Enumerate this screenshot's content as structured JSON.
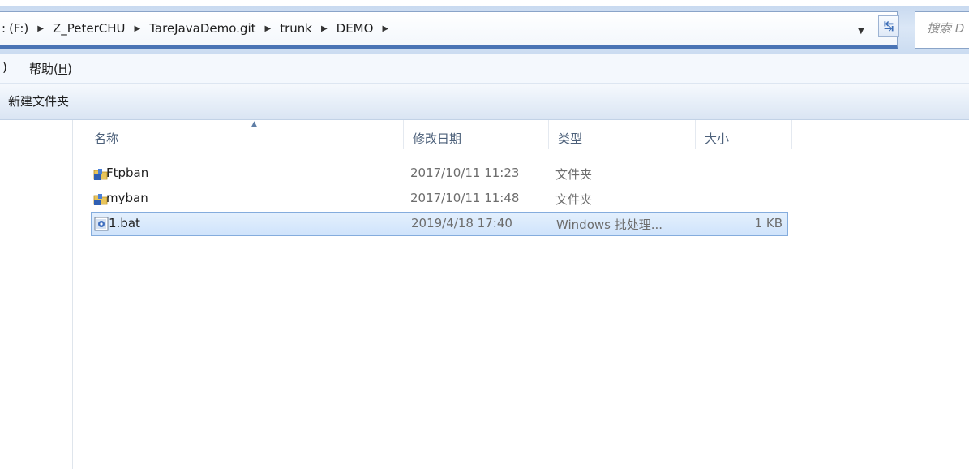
{
  "address": {
    "crumbs": [
      "(F:)",
      "Z_PeterCHU",
      "TareJavaDemo.git",
      "trunk",
      "DEMO"
    ],
    "crumb_prefix": ":",
    "separator_icon": "breadcrumb-arrow-icon",
    "refresh_icon": "refresh-icon",
    "refresh_glyph": "↹",
    "dropdown_icon": "dropdown-arrow-icon",
    "search_placeholder": "搜索 D"
  },
  "menubar": {
    "fragment": ")",
    "help": "帮助",
    "help_key": "H"
  },
  "toolbar": {
    "new_folder": "新建文件夹"
  },
  "columns": {
    "name": "名称",
    "date": "修改日期",
    "type": "类型",
    "size": "大小"
  },
  "files": [
    {
      "name": "Ftpban",
      "date": "2017/10/11 11:23",
      "type": "文件夹",
      "size": "",
      "icon": "folder-icon",
      "selected": false
    },
    {
      "name": "myban",
      "date": "2017/10/11 11:48",
      "type": "文件夹",
      "size": "",
      "icon": "folder-icon",
      "selected": false
    },
    {
      "name": "1.bat",
      "date": "2019/4/18 17:40",
      "type": "Windows 批处理...",
      "size": "1 KB",
      "icon": "batch-file-icon",
      "selected": true
    }
  ],
  "colors": {
    "accent": "#4a74b5",
    "selection": "#cfe3fb",
    "selection_border": "#84acdd"
  }
}
